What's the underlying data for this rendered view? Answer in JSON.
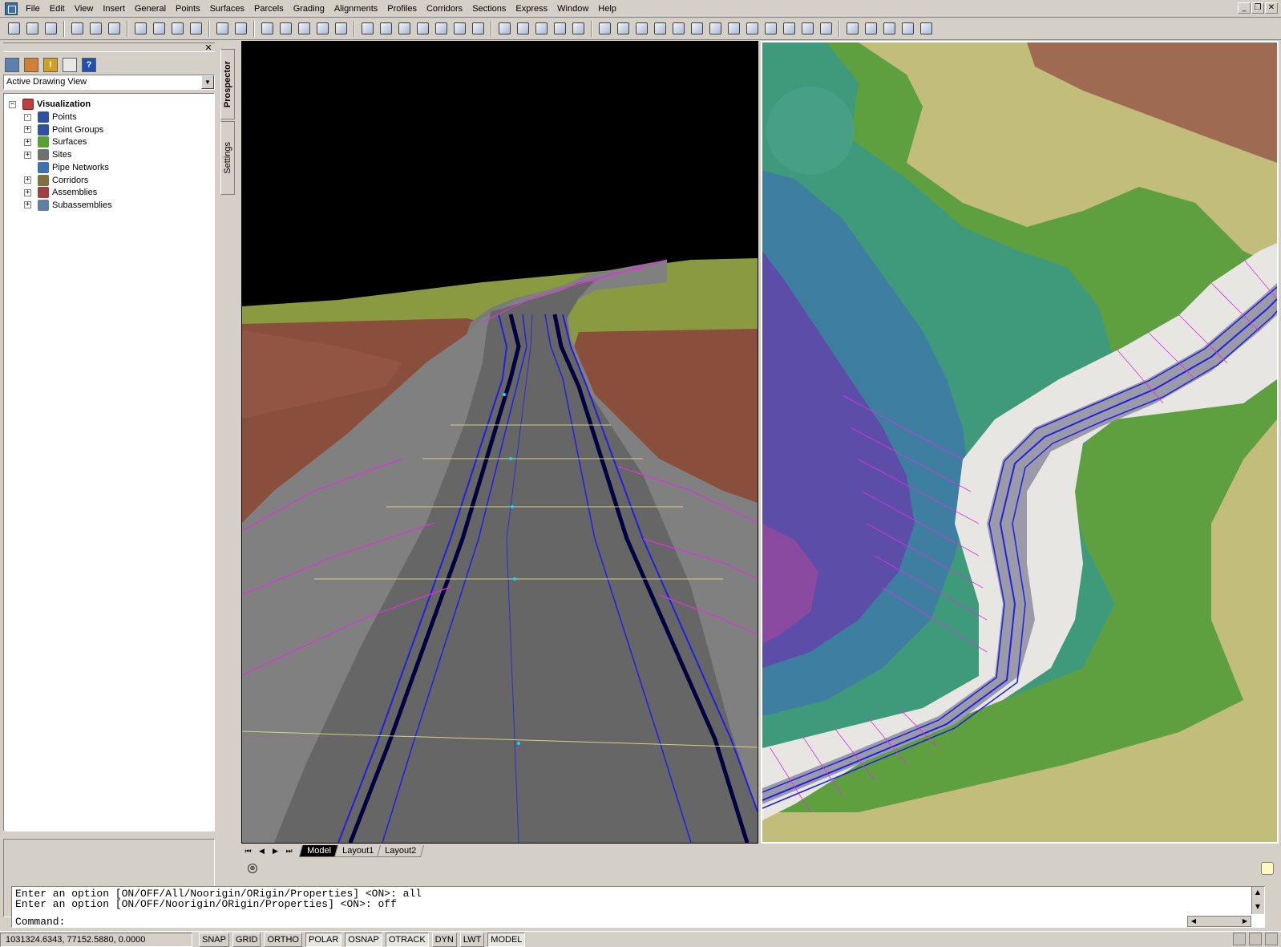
{
  "menu": [
    "File",
    "Edit",
    "View",
    "Insert",
    "General",
    "Points",
    "Surfaces",
    "Parcels",
    "Grading",
    "Alignments",
    "Profiles",
    "Corridors",
    "Sections",
    "Express",
    "Window",
    "Help"
  ],
  "window_controls": {
    "minimize": "_",
    "restore": "❐",
    "close": "✕"
  },
  "toolbar_icons": [
    "new-icon",
    "open-icon",
    "save-icon",
    "|",
    "print-icon",
    "plot-preview-icon",
    "publish-icon",
    "|",
    "cut-icon",
    "copy-icon",
    "paste-icon",
    "match-properties-icon",
    "|",
    "undo-icon",
    "redo-icon",
    "|",
    "pan-icon",
    "zoom-realtime-icon",
    "zoom-window-icon",
    "zoom-previous-icon",
    "3d-orbit-icon",
    "|",
    "properties-icon",
    "design-center-icon",
    "tool-palettes-icon",
    "sheet-set-icon",
    "markup-icon",
    "quickcalc-icon",
    "help-icon",
    "|",
    "civil-tool-1-icon",
    "civil-tool-2-icon",
    "civil-tool-3-icon",
    "civil-tool-4-icon",
    "civil-tool-5-icon",
    "|",
    "civil-tool-6-icon",
    "civil-tool-7-icon",
    "civil-tool-8-icon",
    "civil-tool-9-icon",
    "civil-tool-10-icon",
    "civil-tool-11-icon",
    "civil-tool-12-icon",
    "civil-tool-13-icon",
    "civil-tool-14-icon",
    "civil-tool-15-icon",
    "civil-tool-16-icon",
    "civil-tool-17-icon",
    "civil-tool-18-icon",
    "|",
    "civil-tool-19-icon",
    "civil-tool-20-icon",
    "civil-tool-21-icon",
    "civil-tool-22-icon",
    "civil-tool-23-icon"
  ],
  "prospector": {
    "close_glyph": "✕",
    "toolbar_icons": [
      "vertical-view-icon",
      "object-filter-icon",
      "warning-icon",
      "window-icon",
      "help-icon"
    ],
    "help_glyph": "?",
    "warning_glyph": "!",
    "view_select": "Active Drawing View",
    "root": {
      "label": "Visualization",
      "expander": "−"
    },
    "items": [
      {
        "label": "Points",
        "expander": "·",
        "icon": "points-icon",
        "color": "#3050a0"
      },
      {
        "label": "Point Groups",
        "expander": "+",
        "icon": "point-groups-icon",
        "color": "#3050a0"
      },
      {
        "label": "Surfaces",
        "expander": "+",
        "icon": "surfaces-icon",
        "color": "#5aa030"
      },
      {
        "label": "Sites",
        "expander": "+",
        "icon": "sites-icon",
        "color": "#707070"
      },
      {
        "label": "Pipe Networks",
        "expander": "",
        "icon": "pipe-networks-icon",
        "color": "#4070b0"
      },
      {
        "label": "Corridors",
        "expander": "+",
        "icon": "corridors-icon",
        "color": "#807040"
      },
      {
        "label": "Assemblies",
        "expander": "+",
        "icon": "assemblies-icon",
        "color": "#a04040"
      },
      {
        "label": "Subassemblies",
        "expander": "+",
        "icon": "subassemblies-icon",
        "color": "#6080a0"
      }
    ]
  },
  "side_tabs": [
    "Prospector",
    "Settings"
  ],
  "layout_tabs": [
    "Model",
    "Layout1",
    "Layout2"
  ],
  "layout_nav": [
    "⏮",
    "◀",
    "▶",
    "⏭"
  ],
  "ucs_glyph": "⊕",
  "command": {
    "lines": [
      "Enter an option [ON/OFF/All/Noorigin/ORigin/Properties] <ON>: all",
      "Enter an option [ON/OFF/Noorigin/ORigin/Properties] <ON>: off"
    ],
    "prompt": "Command:"
  },
  "status": {
    "coords": "1031324.6343, 77152.5880, 0.0000",
    "toggles": [
      "SNAP",
      "GRID",
      "ORTHO",
      "POLAR",
      "OSNAP",
      "OTRACK",
      "DYN",
      "LWT",
      "MODEL"
    ],
    "toggles_on": [
      "POLAR",
      "OSNAP",
      "OTRACK",
      "MODEL"
    ]
  },
  "colors": {
    "road": "#6a6a6a",
    "shoulder": "#808080",
    "sky": "#000000",
    "grass": "#8a9a40",
    "dirt": "#8a4e3c",
    "baseline": "#2020e0",
    "slope_lines": "#e030e0",
    "cross_lines": "#e0e080",
    "cut_fill": "#e8e6e2"
  }
}
